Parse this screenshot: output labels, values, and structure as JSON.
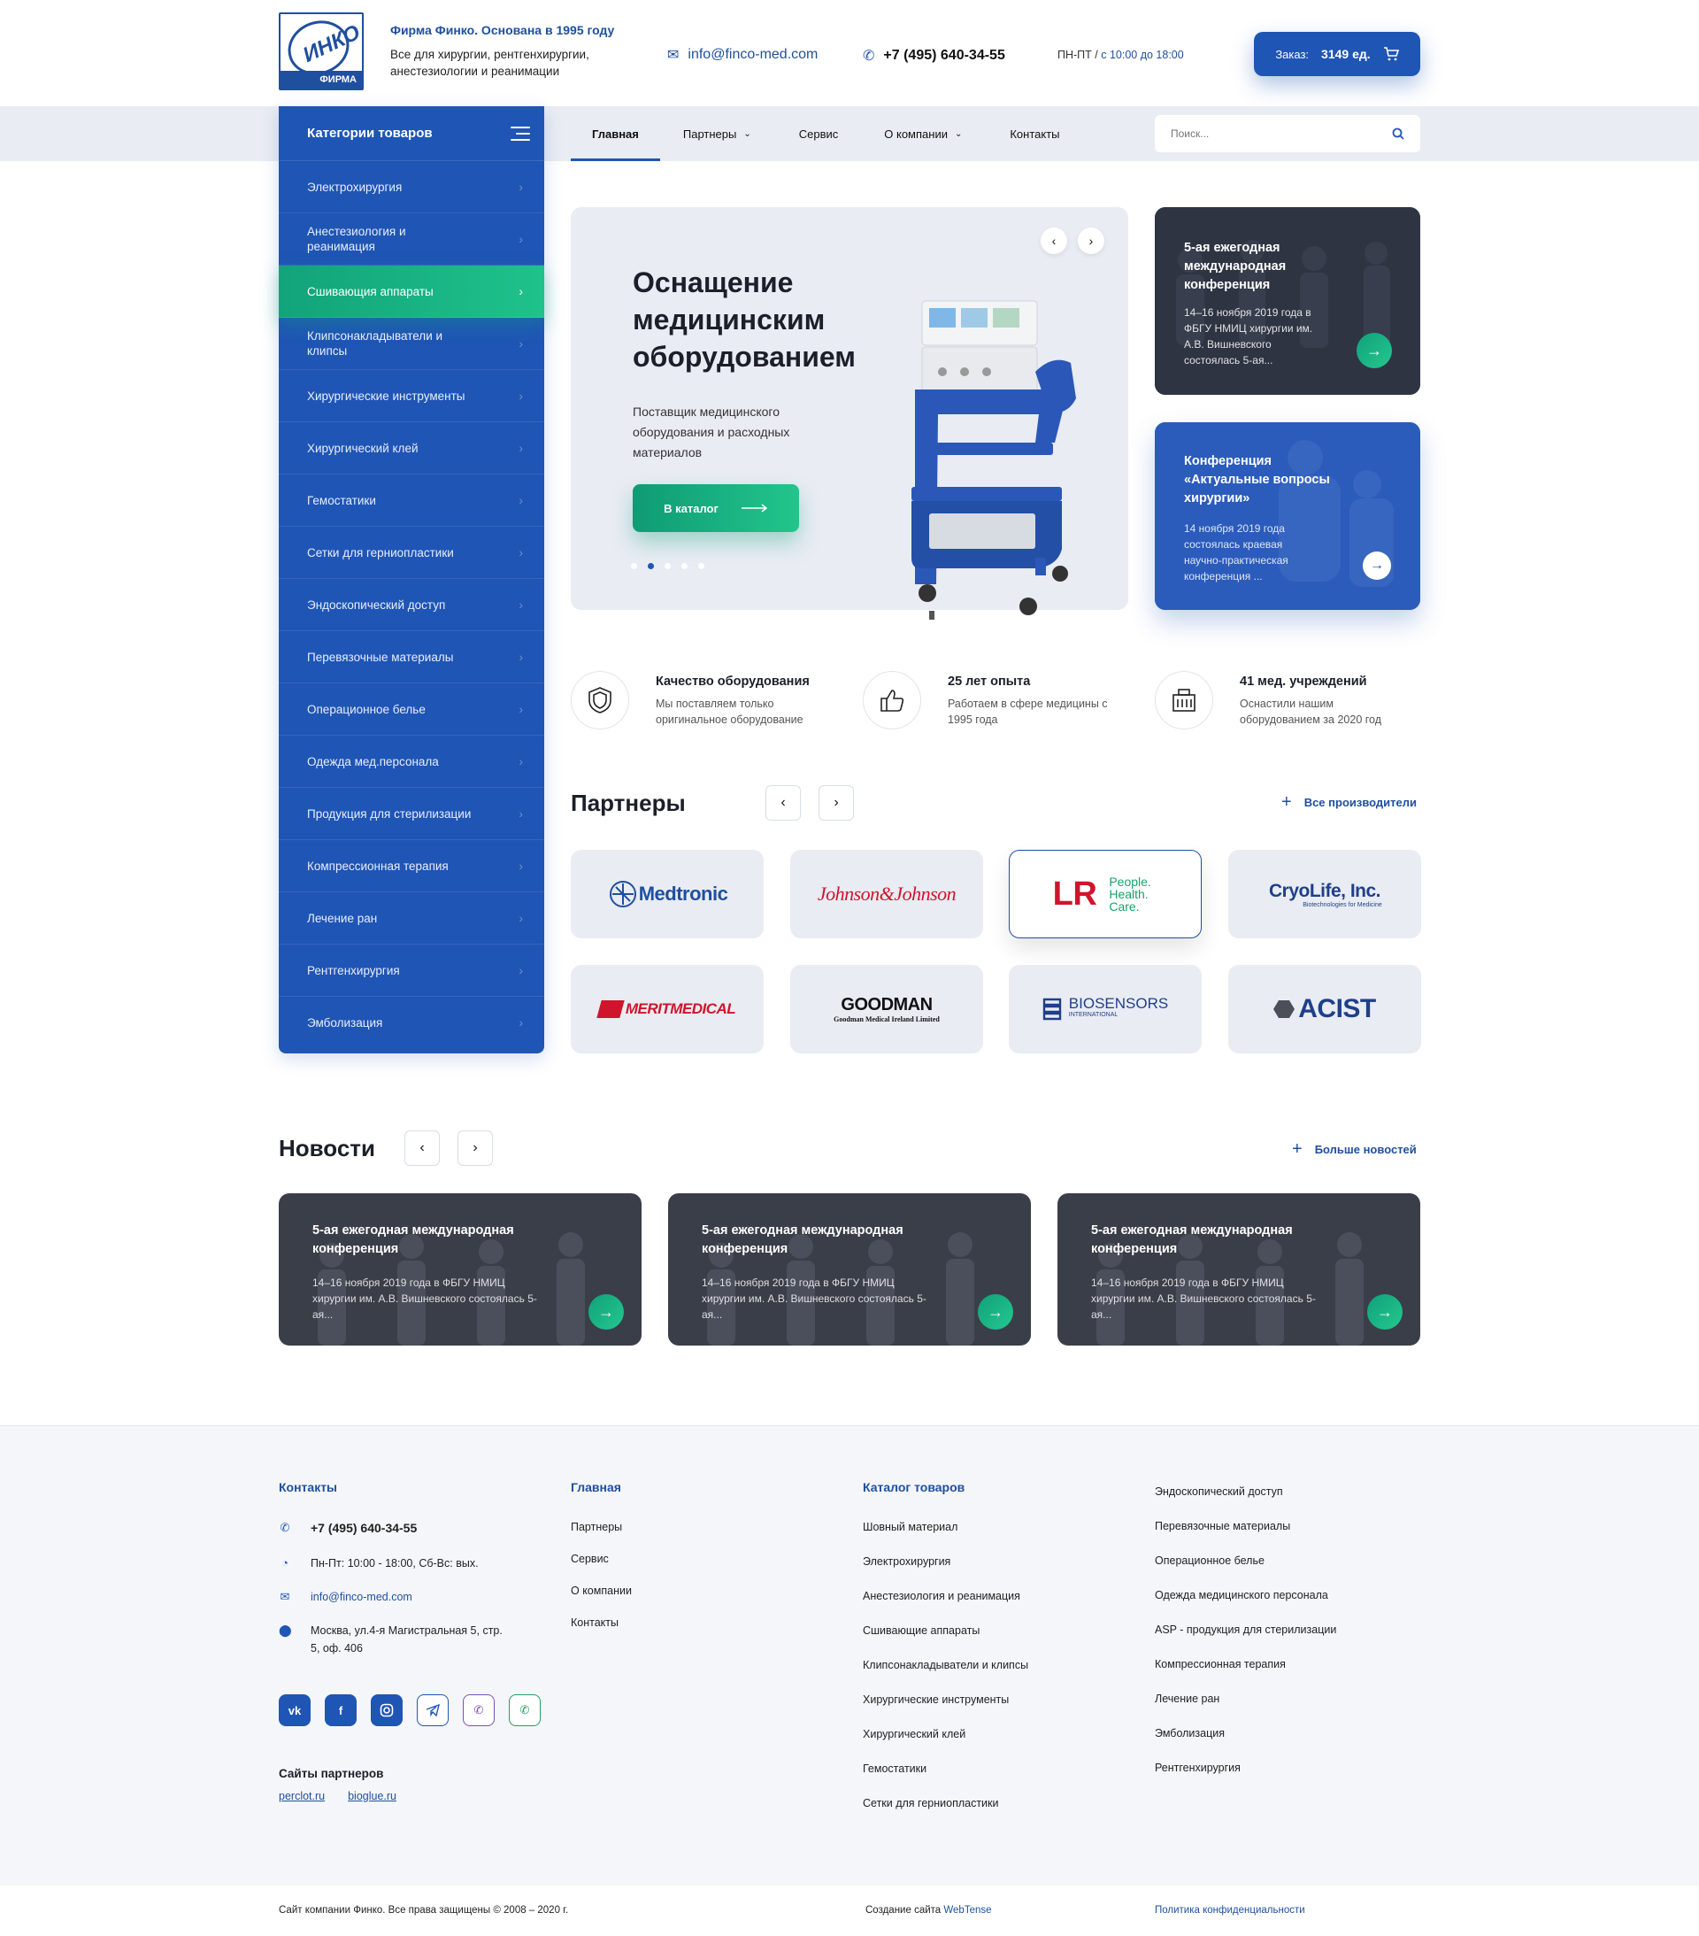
{
  "header": {
    "logo_text": "ИНКО",
    "logo_bar": "ФИРМА",
    "tagline_title": "Фирма Финко. Основана в 1995 году",
    "tagline_sub": "Все для хирургии, рентгенхирургии, анестезиологии и реанимации",
    "email": "info@finco-med.com",
    "phone": "+7 (495) 640-34-55",
    "hours_days": "ПН-ПТ /",
    "hours_time": "с 10:00 до 18:00",
    "order_label": "Заказ:",
    "order_count": "3149 ед."
  },
  "sidebar": {
    "title": "Категории товаров",
    "items": [
      {
        "label": "Электрохирургия"
      },
      {
        "label": "Анестезиология и реанимация"
      },
      {
        "label": "Сшивающия аппараты",
        "active": true
      },
      {
        "label": "Клипсонакладыватели и клипсы"
      },
      {
        "label": "Хирургические инструменты"
      },
      {
        "label": "Хирургический клей"
      },
      {
        "label": "Гемостатики"
      },
      {
        "label": "Сетки для герниопластики"
      },
      {
        "label": "Эндоскопический доступ"
      },
      {
        "label": "Перевязочные материалы"
      },
      {
        "label": "Операционное белье"
      },
      {
        "label": "Одежда мед.персонала"
      },
      {
        "label": "Продукция для стерилизации"
      },
      {
        "label": "Компрессионная терапия"
      },
      {
        "label": "Лечение ран"
      },
      {
        "label": "Рентгенхирургия"
      },
      {
        "label": "Эмболизация"
      }
    ]
  },
  "nav": {
    "items": [
      {
        "label": "Главная",
        "active": true
      },
      {
        "label": "Партнеры",
        "dropdown": true
      },
      {
        "label": "Сервис"
      },
      {
        "label": "О компании",
        "dropdown": true
      },
      {
        "label": "Контакты"
      }
    ],
    "search_placeholder": "Поиск..."
  },
  "hero": {
    "title": "Оснащение медицинским оборудованием",
    "subtitle": "Поставщик медицинского оборудования и расходных материалов",
    "button": "В каталог",
    "slides": 5,
    "current_slide": 2
  },
  "side_news": [
    {
      "title": "5-ая ежегодная международная конференция",
      "text": "14–16 ноября 2019 года в ФБГУ НМИЦ хирургии им. А.В. Вишневского состоялась 5-ая..."
    },
    {
      "title": "Конференция «Актуальные вопросы хирургии»",
      "text": "14 ноября 2019 года состоялась краевая научно-практическая конференция ..."
    }
  ],
  "features": [
    {
      "icon": "shield-icon",
      "title": "Качество оборудования",
      "text": "Мы поставляем только оригинальное оборудование"
    },
    {
      "icon": "thumbs-up-icon",
      "title": "25 лет опыта",
      "text": "Работаем в сфере медицины с 1995 года"
    },
    {
      "icon": "hospital-icon",
      "title": "41 мед. учреждений",
      "text": "Оснастили нашим оборудованием за 2020 год"
    }
  ],
  "partners": {
    "title": "Партнеры",
    "all_link": "Все производители",
    "logos": [
      {
        "name": "Medtronic",
        "color": "#1f4f9f"
      },
      {
        "name": "Johnson&Johnson",
        "color": "#d0142c"
      },
      {
        "name": "LR",
        "tag": "People. Health. Care.",
        "color": "#d0142c",
        "selected": true
      },
      {
        "name": "CryoLife, Inc.",
        "tag": "Biotechnologies for Medicine",
        "color": "#1f3f8a"
      },
      {
        "name": "MERITMEDICAL",
        "color": "#d0142c"
      },
      {
        "name": "GOODMAN",
        "tag": "Goodman Medical Ireland Limited",
        "color": "#111"
      },
      {
        "name": "BIOSENSORS",
        "tag": "INTERNATIONAL",
        "color": "#1f3f8a"
      },
      {
        "name": "ACIST",
        "color": "#1f3f8a"
      }
    ]
  },
  "news": {
    "title": "Новости",
    "more_link": "Больше новостей",
    "items": [
      {
        "title": "5-ая ежегодная международная конференция",
        "text": "14–16 ноября 2019 года в ФБГУ НМИЦ хирургии им. А.В. Вишневского состоялась 5-ая..."
      },
      {
        "title": "5-ая ежегодная международная конференция",
        "text": "14–16 ноября 2019 года в ФБГУ НМИЦ хирургии им. А.В. Вишневского состоялась 5-ая..."
      },
      {
        "title": "5-ая ежегодная международная конференция",
        "text": "14–16 ноября 2019 года в ФБГУ НМИЦ хирургии им. А.В. Вишневского состоялась 5-ая..."
      }
    ]
  },
  "footer": {
    "contacts_title": "Контакты",
    "phone": "+7 (495) 640-34-55",
    "hours": "Пн-Пт: 10:00 - 18:00, Сб-Вс: вых.",
    "email": "info@finco-med.com",
    "address": "Москва, ул.4-я Магистральная 5, стр. 5, оф. 406",
    "social": [
      "vk",
      "f",
      "instagram",
      "telegram",
      "viber",
      "whatsapp"
    ],
    "partner_sites_title": "Сайты партнеров",
    "partner_sites": [
      "perclot.ru",
      "bioglue.ru"
    ],
    "menu_title": "Главная",
    "menu": [
      "Партнеры",
      "Сервис",
      "О компании",
      "Контакты"
    ],
    "catalog_title": "Каталог товаров",
    "catalog_col1": [
      "Шовный материал",
      "Электрохирургия",
      "Анестезиология и реанимация",
      "Сшивающие аппараты",
      "Клипсонакладыватели и клипсы",
      "Хирургические инструменты",
      "Хирургический клей",
      "Гемостатики",
      "Сетки для герниопластики"
    ],
    "catalog_col2": [
      "Эндоскопический доступ",
      "Перевязочные материалы",
      "Операционное белье",
      "Одежда медицинского персонала",
      "ASP - продукция для стерилизации",
      "Компрессионная терапия",
      "Лечение ран",
      "Эмболизация",
      "Рентгенхирургия"
    ],
    "copyright": "Сайт компании Финко. Все права защищены © 2008 – 2020 г.",
    "made_by_label": "Создание сайта",
    "made_by": "WebTense",
    "privacy": "Политика конфиденциальности"
  }
}
